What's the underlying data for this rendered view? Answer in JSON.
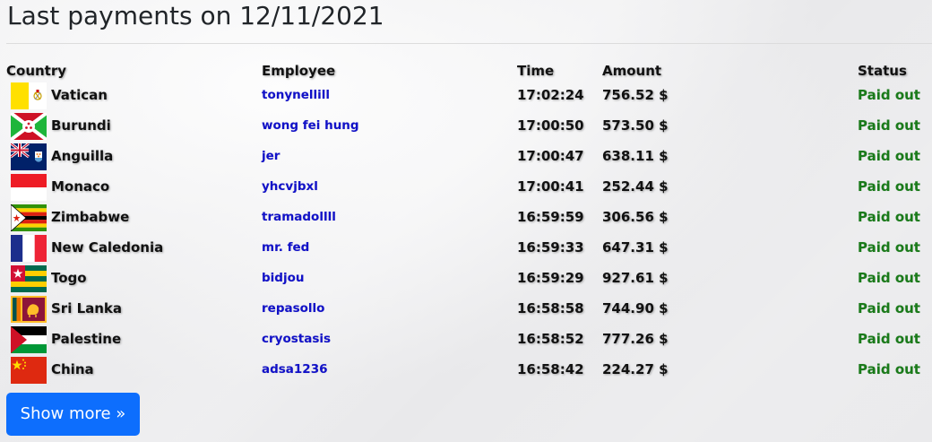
{
  "page": {
    "title": "Last payments on 12/11/2021"
  },
  "table": {
    "headers": {
      "country": "Country",
      "employee": "Employee",
      "time": "Time",
      "amount": "Amount",
      "status": "Status"
    },
    "rows": [
      {
        "flag": "vatican-flag-icon",
        "country": "Vatican",
        "employee": "tonynellill",
        "time": "17:02:24",
        "amount": "756.52 $",
        "status": "Paid out"
      },
      {
        "flag": "burundi-flag-icon",
        "country": "Burundi",
        "employee": "wong fei hung",
        "time": "17:00:50",
        "amount": "573.50 $",
        "status": "Paid out"
      },
      {
        "flag": "anguilla-flag-icon",
        "country": "Anguilla",
        "employee": "jer",
        "time": "17:00:47",
        "amount": "638.11 $",
        "status": "Paid out"
      },
      {
        "flag": "monaco-flag-icon",
        "country": "Monaco",
        "employee": "yhcvjbxl",
        "time": "17:00:41",
        "amount": "252.44 $",
        "status": "Paid out"
      },
      {
        "flag": "zimbabwe-flag-icon",
        "country": "Zimbabwe",
        "employee": "tramadollll",
        "time": "16:59:59",
        "amount": "306.56 $",
        "status": "Paid out"
      },
      {
        "flag": "new-caledonia-flag-icon",
        "country": "New Caledonia",
        "employee": "mr. fed",
        "time": "16:59:33",
        "amount": "647.31 $",
        "status": "Paid out"
      },
      {
        "flag": "togo-flag-icon",
        "country": "Togo",
        "employee": "bidjou",
        "time": "16:59:29",
        "amount": "927.61 $",
        "status": "Paid out"
      },
      {
        "flag": "sri-lanka-flag-icon",
        "country": "Sri Lanka",
        "employee": "repasollo",
        "time": "16:58:58",
        "amount": "744.90 $",
        "status": "Paid out"
      },
      {
        "flag": "palestine-flag-icon",
        "country": "Palestine",
        "employee": "cryostasis",
        "time": "16:58:52",
        "amount": "777.26 $",
        "status": "Paid out"
      },
      {
        "flag": "china-flag-icon",
        "country": "China",
        "employee": "adsa1236",
        "time": "16:58:42",
        "amount": "224.27 $",
        "status": "Paid out"
      }
    ]
  },
  "actions": {
    "show_more_label": "Show more »"
  },
  "colors": {
    "link": "#1111c8",
    "status_paid": "#1a7a1a",
    "button": "#0d6efd"
  }
}
